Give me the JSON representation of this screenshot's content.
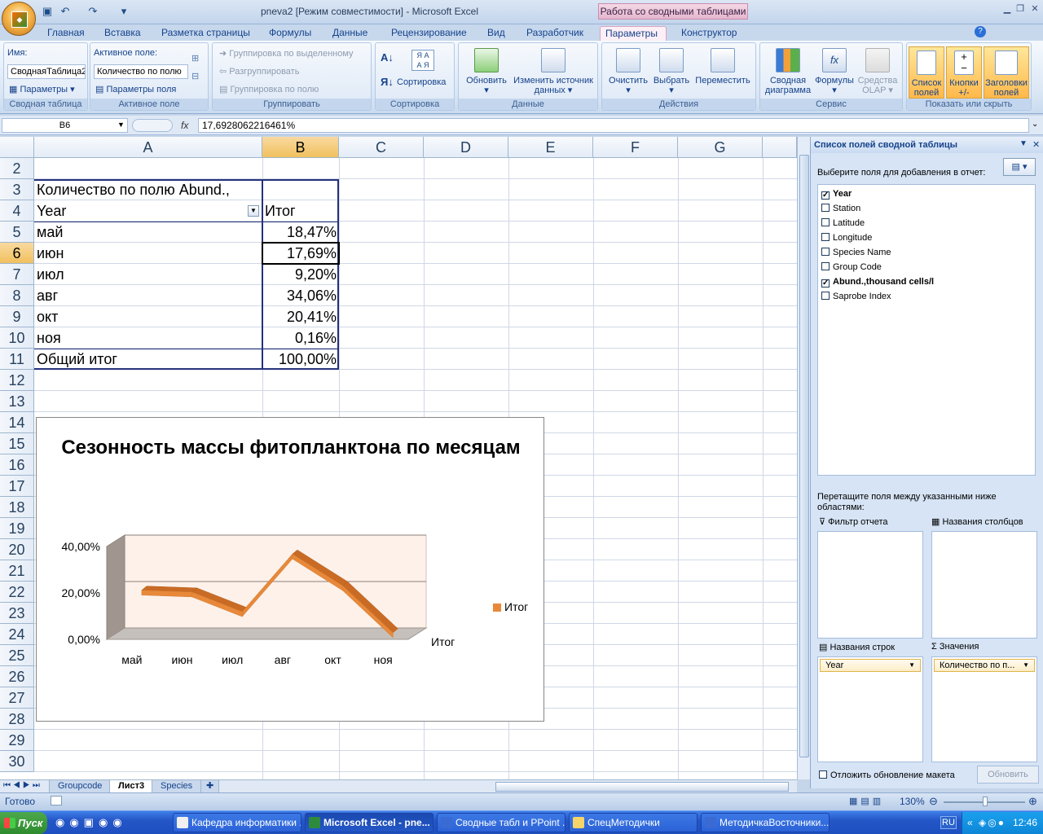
{
  "window": {
    "title": "pneva2  [Режим совместимости] - Microsoft Excel",
    "context_title": "Работа со сводными таблицами"
  },
  "tabs": [
    "Главная",
    "Вставка",
    "Разметка страницы",
    "Формулы",
    "Данные",
    "Рецензирование",
    "Вид",
    "Разработчик",
    "Параметры",
    "Конструктор"
  ],
  "active_tab": "Параметры",
  "ribbon": {
    "pivot": {
      "name_label": "Имя:",
      "name_value": "СводнаяТаблица2",
      "params": "Параметры",
      "group": "Сводная таблица"
    },
    "field": {
      "label": "Активное поле:",
      "value": "Количество по полю",
      "params": "Параметры поля",
      "group": "Активное поле"
    },
    "grouping": {
      "by_selection": "Группировка по выделенному",
      "ungroup": "Разгруппировать",
      "by_field": "Группировка по полю",
      "group": "Группировать"
    },
    "sort": {
      "button": "Сортировка",
      "group": "Сортировка"
    },
    "data": {
      "refresh": "Обновить",
      "change_source": "Изменить источник данных",
      "group": "Данные"
    },
    "actions": {
      "clear": "Очистить",
      "select": "Выбрать",
      "move": "Переместить",
      "group": "Действия"
    },
    "service": {
      "chart": "Сводная диаграмма",
      "formulas": "Формулы",
      "olap": "Средства OLAP",
      "group": "Сервис"
    },
    "show": {
      "field_list": "Список полей",
      "buttons": "Кнопки +/-",
      "headers": "Заголовки полей",
      "group": "Показать или скрыть"
    }
  },
  "formula_bar": {
    "cell": "B6",
    "fx": "fx",
    "value": "17,6928062216461%"
  },
  "columns": [
    "A",
    "B",
    "C",
    "D",
    "E",
    "F",
    "G"
  ],
  "selected_column": "B",
  "rows": [
    "2",
    "3",
    "4",
    "5",
    "6",
    "7",
    "8",
    "9",
    "10",
    "11",
    "12",
    "13",
    "14",
    "15",
    "16",
    "17",
    "18",
    "19",
    "20",
    "21",
    "22",
    "23",
    "24",
    "25",
    "26",
    "27",
    "28",
    "29",
    "30"
  ],
  "selected_row": "6",
  "pivot": {
    "header": "Количество по полю Abund.,",
    "row_label": "Year",
    "value_label": "Итог",
    "rows": [
      {
        "label": "май",
        "value": "18,47%"
      },
      {
        "label": "июн",
        "value": "17,69%"
      },
      {
        "label": "июл",
        "value": "9,20%"
      },
      {
        "label": "авг",
        "value": "34,06%"
      },
      {
        "label": "окт",
        "value": "20,41%"
      },
      {
        "label": "ноя",
        "value": "0,16%"
      }
    ],
    "total_label": "Общий итог",
    "total_value": "100,00%"
  },
  "chart_data": {
    "type": "line",
    "title": "Сезонность массы фитопланктона по месяцам",
    "categories": [
      "май",
      "июн",
      "июл",
      "авг",
      "окт",
      "ноя"
    ],
    "series": [
      {
        "name": "Итог",
        "values": [
          18.47,
          17.69,
          9.2,
          34.06,
          20.41,
          0.16
        ],
        "color": "#e8893a"
      }
    ],
    "ytick_labels": [
      "0,00%",
      "20,00%",
      "40,00%"
    ],
    "ylim": [
      0,
      40
    ],
    "depth_axis_label": "Итог",
    "legend": "right",
    "grid": true
  },
  "field_pane": {
    "title": "Список полей сводной таблицы",
    "choose_label": "Выберите поля для добавления в отчет:",
    "fields": [
      {
        "name": "Year",
        "checked": true
      },
      {
        "name": "Station",
        "checked": false
      },
      {
        "name": "Latitude",
        "checked": false
      },
      {
        "name": "Longitude",
        "checked": false
      },
      {
        "name": "Species Name",
        "checked": false
      },
      {
        "name": "Group Code",
        "checked": false
      },
      {
        "name": "Abund.,thousand cells/l",
        "checked": true
      },
      {
        "name": "Saprobe Index",
        "checked": false
      }
    ],
    "drag_hint": "Перетащите поля между указанными ниже областями:",
    "report_filter": "Фильтр отчета",
    "column_labels": "Названия столбцов",
    "row_labels": "Названия строк",
    "values": "Значения",
    "row_field": "Year",
    "value_field": "Количество по п...",
    "defer_label": "Отложить обновление макета",
    "update_button": "Обновить"
  },
  "sheets": [
    "Groupcode",
    "Лист3",
    "Species"
  ],
  "active_sheet": "Лист3",
  "status": {
    "ready": "Готово",
    "zoom": "130%"
  },
  "taskbar": {
    "start": "Пуск",
    "tasks": [
      "Кафедра информатики ...",
      "Microsoft Excel - pne...",
      "Сводные табл и PPoint ...",
      "СпецМетодички",
      "МетодичкаВосточники..."
    ],
    "lang": "RU",
    "time": "12:46"
  }
}
